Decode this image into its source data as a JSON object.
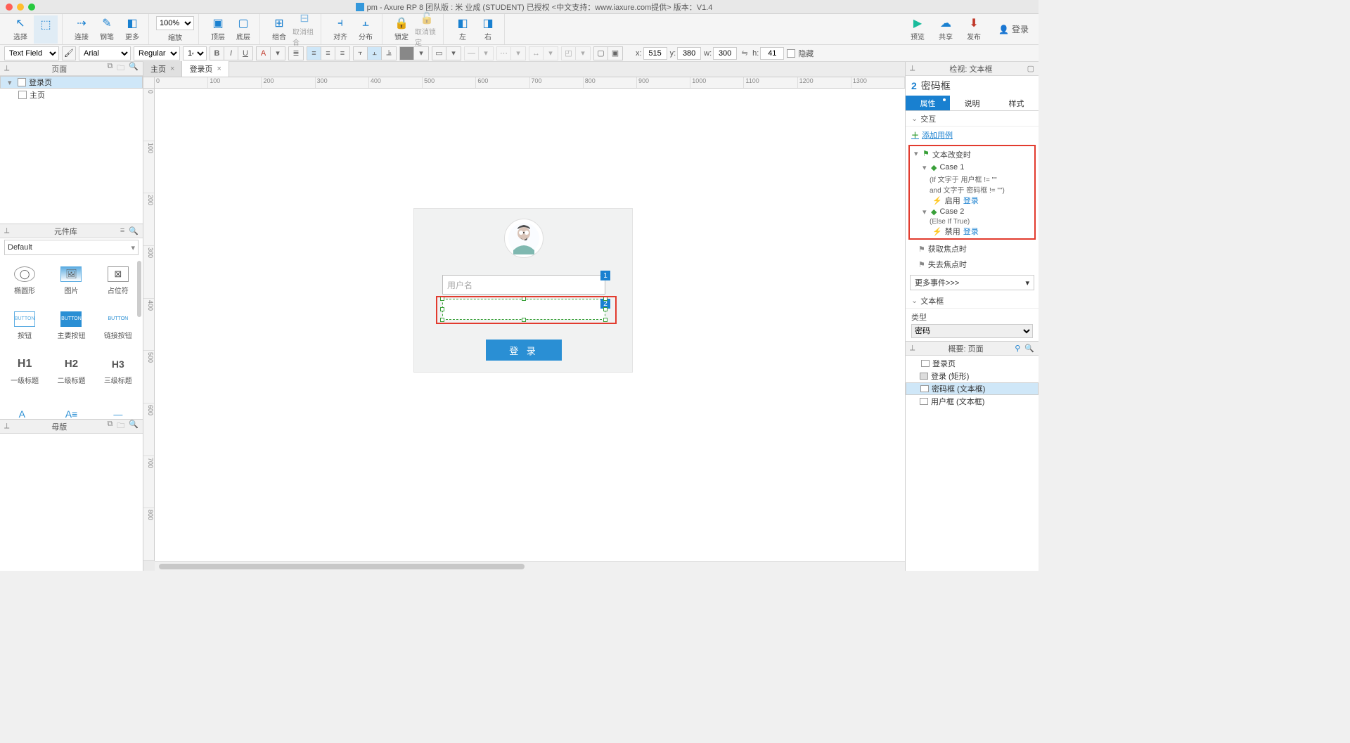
{
  "titlebar": {
    "title": "pm - Axure RP 8 团队版 : 米 业成 (STUDENT) 已授权   <中文支持：www.iaxure.com提供> 版本：V1.4"
  },
  "toolbar1": {
    "select": "选择",
    "connect": "连接",
    "pen": "钢笔",
    "more": "更多",
    "zoom": "100%",
    "zoomLbl": "缩放",
    "front": "顶层",
    "back": "底层",
    "group": "组合",
    "ungroup": "取消组合",
    "align": "对齐",
    "distribute": "分布",
    "lock": "锁定",
    "unlock": "取消锁定",
    "left": "左",
    "right": "右",
    "preview": "预览",
    "share": "共享",
    "publish": "发布",
    "login": "登录"
  },
  "toolbar2": {
    "widgetStyle": "Text Field",
    "font": "Arial",
    "weight": "Regular",
    "size": "14",
    "x": "515",
    "y": "380",
    "w": "300",
    "h": "41",
    "hidden": "隐藏",
    "xl": "x:",
    "yl": "y:",
    "wl": "w:",
    "hl": "h:"
  },
  "panels": {
    "pages": "页面",
    "widgets": "元件库",
    "masters": "母版",
    "inspector": "检视: 文本框",
    "outline": "概要: 页面"
  },
  "pagesTree": {
    "login": "登录页",
    "home": "主页"
  },
  "widgetLib": {
    "default": "Default",
    "items": [
      {
        "label": "椭圆形"
      },
      {
        "label": "图片"
      },
      {
        "label": "占位符"
      },
      {
        "label": "按钮",
        "txt": "BUTTON"
      },
      {
        "label": "主要按钮",
        "txt": "BUTTON"
      },
      {
        "label": "链接按钮",
        "txt": "BUTTON"
      },
      {
        "label": "一级标题",
        "txt": "H1"
      },
      {
        "label": "二级标题",
        "txt": "H2"
      },
      {
        "label": "三级标题",
        "txt": "H3"
      },
      {
        "label": "",
        "txt": "A_"
      },
      {
        "label": "",
        "txt": "A≡"
      },
      {
        "label": "",
        "txt": "—"
      }
    ]
  },
  "tabs": {
    "main": "主页",
    "login": "登录页"
  },
  "rulerH": [
    "0",
    "100",
    "200",
    "300",
    "400",
    "500",
    "600",
    "700",
    "800",
    "900",
    "1000",
    "1100",
    "1200",
    "1300"
  ],
  "rulerV": [
    "0",
    "100",
    "200",
    "300",
    "400",
    "500",
    "600",
    "700",
    "800"
  ],
  "mockup": {
    "usernamePlaceholder": "用户名",
    "badge1": "1",
    "badge2": "2",
    "loginBtn": "登 录"
  },
  "inspector": {
    "shapeNum": "2",
    "shapeName": "密码框",
    "tabProps": "属性",
    "tabNotes": "说明",
    "tabStyle": "样式",
    "secInteractions": "交互",
    "addCase": "添加用例",
    "evTextChange": "文本改变时",
    "case1": "Case 1",
    "case1cond1": "(If 文字于 用户框 != \"\"",
    "case1cond2": "and 文字于 密码框 != \"\")",
    "case1action": "启用",
    "case1target": "登录",
    "case2": "Case 2",
    "case2cond": "(Else If True)",
    "case2action": "禁用",
    "case2target": "登录",
    "evGotFocus": "获取焦点时",
    "evLostFocus": "失去焦点时",
    "moreEvents": "更多事件>>>",
    "secTextField": "文本框",
    "typeLabel": "类型",
    "typeValue": "密码"
  },
  "outlineTree": {
    "root": "登录页",
    "shape": "登录 (矩形)",
    "pwd": "密码框 (文本框)",
    "user": "用户框 (文本框)"
  }
}
